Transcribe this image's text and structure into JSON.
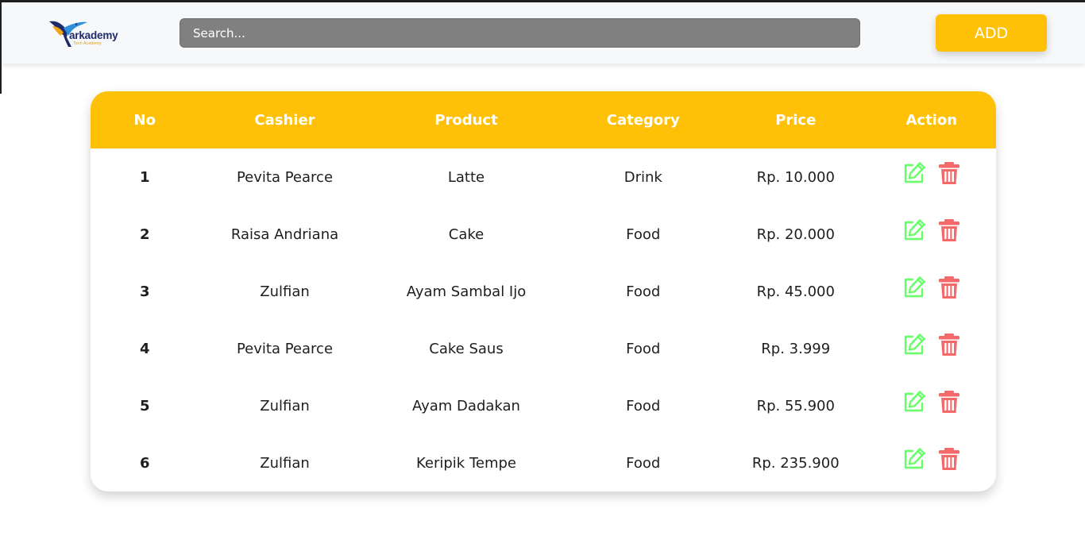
{
  "header": {
    "brand_name": "arkademy",
    "brand_tagline": "Tech Academy",
    "search_placeholder": "Search...",
    "add_label": "ADD"
  },
  "table": {
    "columns": [
      "No",
      "Cashier",
      "Product",
      "Category",
      "Price",
      "Action"
    ],
    "rows": [
      {
        "no": "1",
        "cashier": "Pevita Pearce",
        "product": "Latte",
        "category": "Drink",
        "price": "Rp. 10.000"
      },
      {
        "no": "2",
        "cashier": "Raisa Andriana",
        "product": "Cake",
        "category": "Food",
        "price": "Rp. 20.000"
      },
      {
        "no": "3",
        "cashier": "Zulfian",
        "product": "Ayam Sambal Ijo",
        "category": "Food",
        "price": "Rp. 45.000"
      },
      {
        "no": "4",
        "cashier": "Pevita Pearce",
        "product": "Cake Saus",
        "category": "Food",
        "price": "Rp. 3.999"
      },
      {
        "no": "5",
        "cashier": "Zulfian",
        "product": "Ayam Dadakan",
        "category": "Food",
        "price": "Rp. 55.900"
      },
      {
        "no": "6",
        "cashier": "Zulfian",
        "product": "Keripik Tempe",
        "category": "Food",
        "price": "Rp. 235.900"
      }
    ]
  },
  "icons": {
    "edit": "edit-icon",
    "delete": "trash-icon"
  },
  "colors": {
    "accent": "#ffc107",
    "search_bg": "#808080",
    "edit": "#66ff66",
    "delete": "#f46a6a"
  }
}
